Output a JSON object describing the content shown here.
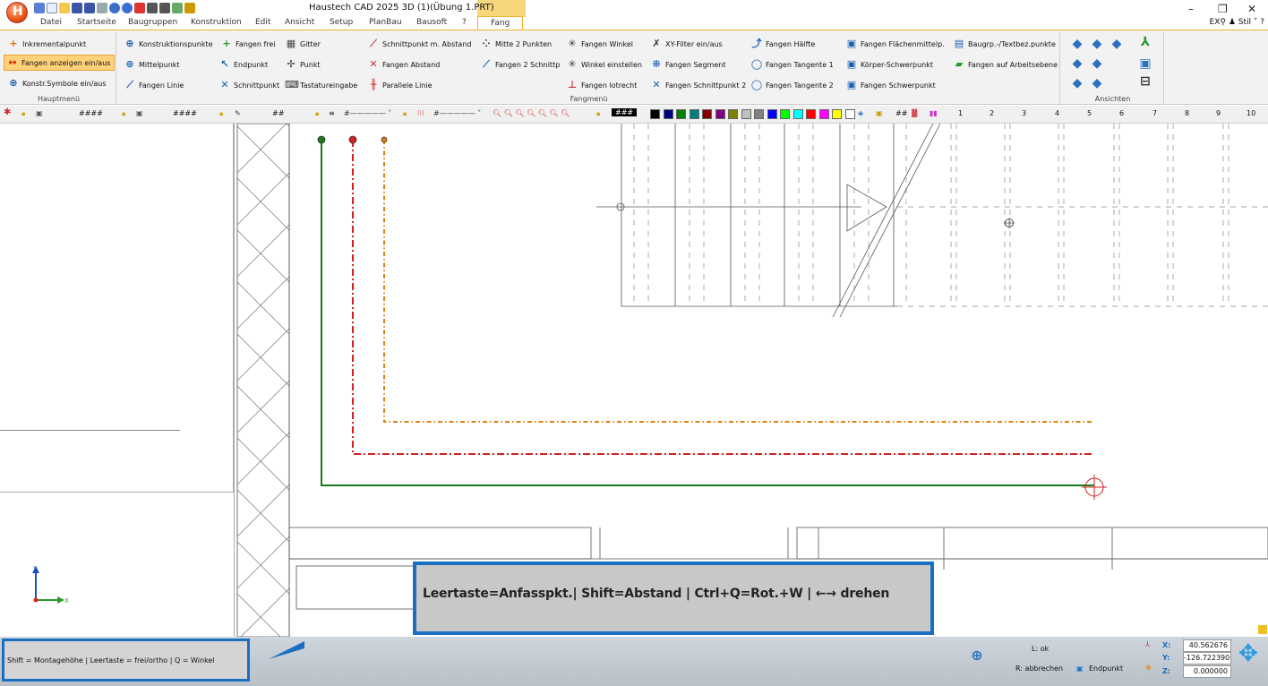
{
  "window": {
    "title": "Haustech CAD 2025 3D (1)(Übung 1.PRT)",
    "minimize": "–",
    "restore": "❐",
    "close": "✕"
  },
  "menu": {
    "tabs": [
      "Datei",
      "Startseite",
      "Baugruppen",
      "Konstruktion",
      "Edit",
      "Ansicht",
      "Setup",
      "PlanBau",
      "Bausoft",
      "?"
    ],
    "active_tab": "Fang",
    "right": "EX⚲  ♟ Stil  ˅ ?"
  },
  "ribbon": {
    "hauptmenu": {
      "label": "Hauptmenü",
      "items": [
        "Inkrementalpunkt",
        "Fangen anzeigen ein/aus",
        "Konstr.Symbole ein/aus"
      ]
    },
    "fangmenu": {
      "label": "Fangmenü",
      "items": [
        "Konstruktionspunkte",
        "Fangen frei",
        "Gitter",
        "Mittelpunkt",
        "Endpunkt",
        "Punkt",
        "Fangen Linie",
        "Schnittpunkt",
        "Tastatureingabe",
        "Schnittpunkt m. Abstand",
        "Fangen Abstand",
        "Parallele Linie",
        "Mitte 2 Punkten",
        "Fangen 2 Schnittp",
        "Fangen Winkel",
        "Winkel einstellen",
        "Fangen lotrecht",
        "XY-Filter ein/aus",
        "Fangen Segment",
        "Fangen Schnittpunkt 2",
        "Fangen Hälfte",
        "Fangen Tangente 1",
        "Fangen Tangente 2",
        "Fangen Flächenmittelp.",
        "Körper-Schwerpunkt",
        "Fangen Schwerpunkt",
        "Baugrp.-/Textbez.punkte",
        "Fangen auf Arbeitsebene"
      ]
    },
    "ansichten": {
      "label": "Ansichten"
    }
  },
  "toolbar": {
    "hash4a": "####",
    "hash4b": "####",
    "hash2": "##",
    "hash3": "###",
    "hash2b": "##",
    "numbers": [
      "1",
      "2",
      "3",
      "4",
      "5",
      "6",
      "7",
      "8",
      "9",
      "10"
    ],
    "swatches": [
      "#000000",
      "#000080",
      "#008000",
      "#008080",
      "#800000",
      "#800080",
      "#808000",
      "#c0c0c0",
      "#808080",
      "#0000ff",
      "#00ff00",
      "#00ffff",
      "#ff0000",
      "#ff00ff",
      "#ffff00",
      "#ffffff"
    ]
  },
  "axis": {
    "x": "X",
    "y": "Y"
  },
  "status": {
    "hint_left": "Shift = Montagehöhe | Leertaste = frei/ortho | Q = Winkel",
    "hint_main": "Leertaste=Anfasspkt.| Shift=Abstand | Ctrl+Q=Rot.+W | ←→ drehen",
    "l_ok": "L: ok",
    "r_cancel": "R: abbrechen",
    "snap": "Endpunkt"
  },
  "coords": {
    "x_label": "X:",
    "y_label": "Y:",
    "z_label": "Z:",
    "x": "40.562676",
    "y": "-126.722390",
    "z": "0.000000"
  }
}
